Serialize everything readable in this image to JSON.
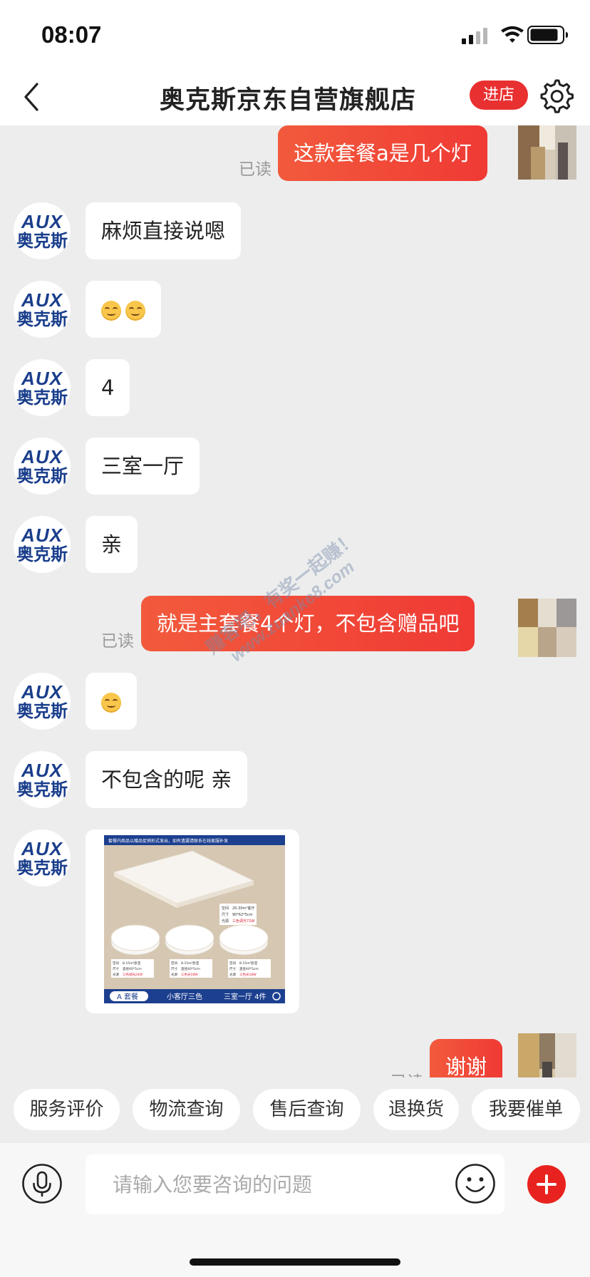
{
  "status_bar": {
    "time": "08:07"
  },
  "nav": {
    "title": "奥克斯京东自营旗舰店",
    "enter_store": "进店"
  },
  "shop_avatar": {
    "brand_en": "AUX",
    "brand_cn": "奥克斯"
  },
  "messages": [
    {
      "from": "user",
      "text": "这款套餐a是几个灯",
      "read": "已读"
    },
    {
      "from": "shop",
      "text": "麻烦直接说嗯"
    },
    {
      "from": "shop",
      "type": "emoji",
      "emoji": [
        "smiling-face",
        "smiling-face"
      ]
    },
    {
      "from": "shop",
      "text": "4"
    },
    {
      "from": "shop",
      "text": "三室一厅"
    },
    {
      "from": "shop",
      "text": "亲"
    },
    {
      "from": "user",
      "text": "就是主套餐4个灯，不包含赠品吧",
      "read": "已读"
    },
    {
      "from": "shop",
      "type": "emoji",
      "emoji": [
        "smiling-face"
      ]
    },
    {
      "from": "shop",
      "text": "不包含的呢 亲"
    },
    {
      "from": "shop",
      "type": "image",
      "image": {
        "banner": "套餐内商品以赠品促销形式发出，如有遗漏请联系在线客服补发",
        "main_spec": [
          "空间",
          "尺寸",
          "光源"
        ],
        "main_vals": [
          "20-30m²客厅",
          "90*62*5cm",
          "三色调光72W"
        ],
        "sub_spec": [
          "空间",
          "尺寸",
          "光源"
        ],
        "sub_vals": [
          [
            "8-15m²卧室",
            "直径40*5cm",
            "三色调光24W"
          ],
          [
            "8-15m²卧室",
            "直径40*5cm",
            "三色光18W"
          ],
          [
            "8-15m²卧室",
            "直径40*5cm",
            "三色光18W"
          ]
        ],
        "tag": "A 套餐",
        "caption_1": "小客厅三色",
        "caption_2": "三室一厅 4件"
      }
    },
    {
      "from": "user",
      "text": "谢谢",
      "read": "已读"
    }
  ],
  "quick_replies": [
    "服务评价",
    "物流查询",
    "售后查询",
    "退换货",
    "我要催单"
  ],
  "input": {
    "placeholder": "请输入您要咨询的问题",
    "value": ""
  },
  "watermark": {
    "line1": "赚客吧，有奖一起赚！",
    "line2": "www.zuanke8.com"
  },
  "colors": {
    "accent": "#e93030",
    "bubble_gradient": [
      "#f25a3c",
      "#f03a35"
    ],
    "brand_blue": "#1a3e8c"
  }
}
